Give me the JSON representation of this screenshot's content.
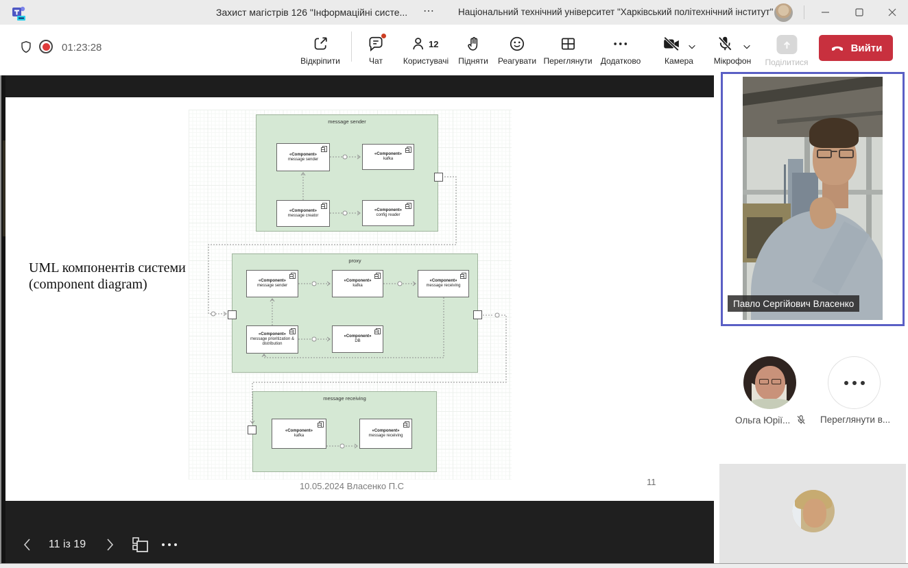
{
  "window": {
    "title": "Захист магістрів 126 \"Інформаційні систе...",
    "title_overflow": "...",
    "org": "Національний технічний університет \"Харківський політехнічний інститут\""
  },
  "toolbar": {
    "timer": "01:23:28",
    "unpin": "Відкріпити",
    "chat": "Чат",
    "participants": "Користувачі",
    "participants_count": "12",
    "raise": "Підняти",
    "react": "Реагувати",
    "view": "Переглянути",
    "more": "Додатково",
    "camera": "Камера",
    "mic": "Мікрофон",
    "share": "Поділитися",
    "leave": "Вийти"
  },
  "slide": {
    "heading_line1": "UML компонентів системи",
    "heading_line2": "(component diagram)",
    "caption": "10.05.2024 Власенко П.С",
    "page_number": "11"
  },
  "diagram": {
    "stereotype": "«Component»",
    "groups": [
      {
        "title": "message sender",
        "items": [
          "message sender",
          "kafka",
          "message creator",
          "config reader"
        ]
      },
      {
        "title": "proxy",
        "items": [
          "message sender",
          "kafka",
          "message receiving",
          "message prioritization & distribution",
          "DB"
        ]
      },
      {
        "title": "message receiving",
        "items": [
          "kafka",
          "message receiving"
        ]
      }
    ]
  },
  "nav": {
    "page_indicator": "11 із 19"
  },
  "sidebar": {
    "main_video_name": "Павло Сергійович Власенко",
    "participant1": "Ольга Юрії...",
    "view_more": "Переглянути в..."
  }
}
